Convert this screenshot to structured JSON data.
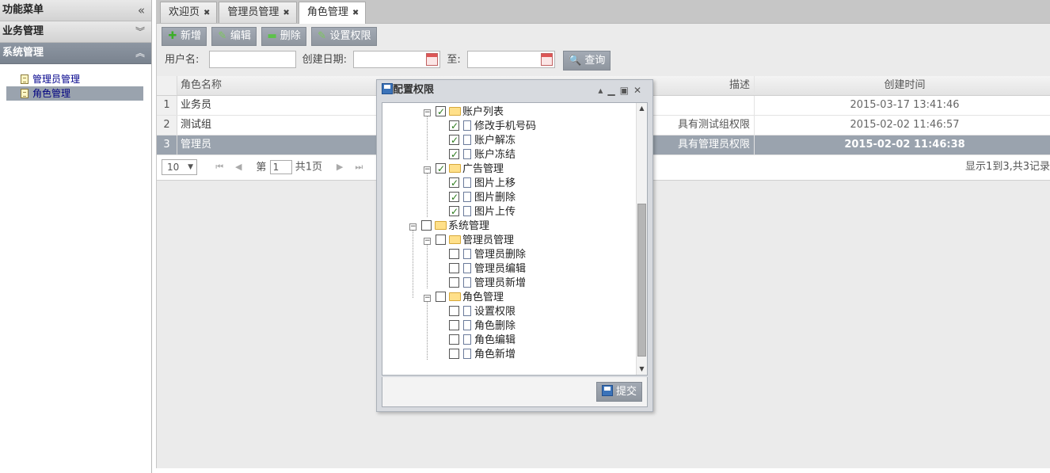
{
  "sidebar": {
    "title": "功能菜单",
    "collapse_icon": "double-chevron-left",
    "sections": [
      {
        "label": "业务管理",
        "icon": "double-chevron-down"
      },
      {
        "label": "系统管理",
        "icon": "double-chevron-up"
      }
    ],
    "items": [
      {
        "label": "管理员管理"
      },
      {
        "label": "角色管理"
      }
    ]
  },
  "tabs": [
    {
      "label": "欢迎页"
    },
    {
      "label": "管理员管理"
    },
    {
      "label": "角色管理"
    }
  ],
  "toolbar": {
    "add": "新增",
    "edit": "编辑",
    "delete": "删除",
    "set_permission": "设置权限"
  },
  "search": {
    "username_label": "用户名:",
    "date_label": "创建日期:",
    "to_label": "至:",
    "query_label": "查询"
  },
  "grid": {
    "columns": {
      "name": "角色名称",
      "desc": "描述",
      "time": "创建时间"
    },
    "rows": [
      {
        "num": "1",
        "name": "业务员",
        "desc": "",
        "time": "2015-03-17 13:41:46"
      },
      {
        "num": "2",
        "name": "测试组",
        "desc": "具有测试组权限",
        "time": "2015-02-02 11:46:57"
      },
      {
        "num": "3",
        "name": "管理员",
        "desc": "具有管理员权限",
        "time": "2015-02-02 11:46:38"
      }
    ]
  },
  "pager": {
    "page_size": "10",
    "page_prefix": "第",
    "page_value": "1",
    "page_suffix": "共1页",
    "info": "显示1到3,共3记录"
  },
  "dialog": {
    "title": "配置权限",
    "submit": "提交",
    "tree": [
      {
        "label": "账户列表",
        "checked": true
      },
      {
        "label": "修改手机号码",
        "checked": true
      },
      {
        "label": "账户解冻",
        "checked": true
      },
      {
        "label": "账户冻结",
        "checked": true
      },
      {
        "label": "广告管理",
        "checked": true
      },
      {
        "label": "图片上移",
        "checked": true
      },
      {
        "label": "图片删除",
        "checked": true
      },
      {
        "label": "图片上传",
        "checked": true
      },
      {
        "label": "系统管理",
        "checked": false
      },
      {
        "label": "管理员管理",
        "checked": false
      },
      {
        "label": "管理员删除",
        "checked": false
      },
      {
        "label": "管理员编辑",
        "checked": false
      },
      {
        "label": "管理员新增",
        "checked": false
      },
      {
        "label": "角色管理",
        "checked": false
      },
      {
        "label": "设置权限",
        "checked": false
      },
      {
        "label": "角色删除",
        "checked": false
      },
      {
        "label": "角色编辑",
        "checked": false
      },
      {
        "label": "角色新增",
        "checked": false
      }
    ]
  }
}
